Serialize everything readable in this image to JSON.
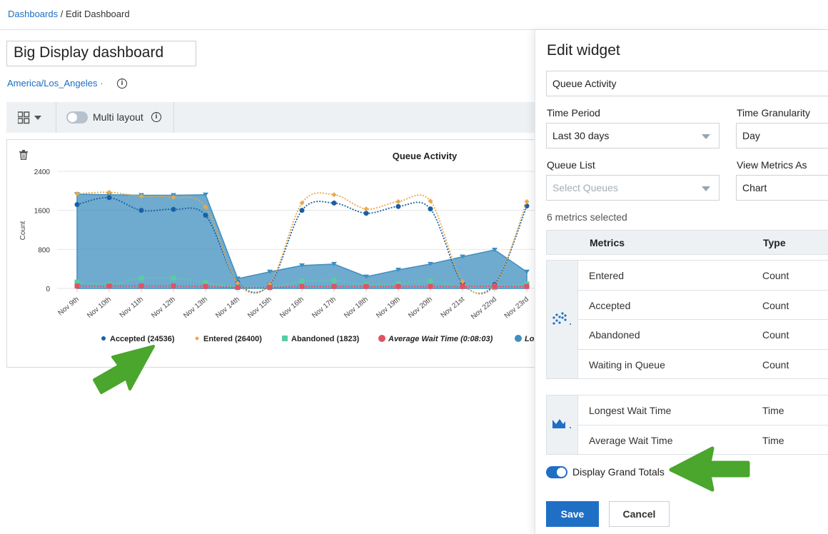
{
  "breadcrumb": {
    "root": "Dashboards",
    "separator": " / ",
    "current": "Edit Dashboard"
  },
  "dashboard": {
    "title": "Big Display dashboard",
    "timezone": "America/Los_Angeles ·"
  },
  "toolbar": {
    "multi_layout_label": "Multi layout",
    "multi_layout_on": false
  },
  "widget": {
    "title": "Queue Activity",
    "ylabel": "Count",
    "legend": [
      {
        "label": "Accepted (24536)",
        "color": "#1a5fa6",
        "marker": "circle"
      },
      {
        "label": "Entered (26400)",
        "color": "#e7a94a",
        "marker": "diamond"
      },
      {
        "label": "Abandoned (1823)",
        "color": "#5ccba4",
        "marker": "square"
      },
      {
        "label": "Average Wait Time (0:08:03)",
        "color": "#e05264",
        "marker": "circle"
      },
      {
        "label": "Lon",
        "color": "#3f8fbf",
        "marker": "circle"
      }
    ]
  },
  "chart_data": {
    "type": "line",
    "title": "Queue Activity",
    "ylabel": "Count",
    "ylim": [
      0,
      2400
    ],
    "yticks": [
      0,
      800,
      1600,
      2400
    ],
    "categories": [
      "Nov 9th",
      "Nov 10th",
      "Nov 11th",
      "Nov 12th",
      "Nov 13th",
      "Nov 14th",
      "Nov 15th",
      "Nov 16th",
      "Nov 17th",
      "Nov 18th",
      "Nov 19th",
      "Nov 20th",
      "Nov 21st",
      "Nov 22nd",
      "Nov 23rd"
    ],
    "series": [
      {
        "name": "Longest Wait Time",
        "kind": "area",
        "color": "#3f8fbf",
        "values": [
          1930,
          1920,
          1910,
          1910,
          1920,
          200,
          340,
          470,
          500,
          240,
          380,
          500,
          650,
          790,
          340
        ]
      },
      {
        "name": "Accepted",
        "kind": "line",
        "color": "#1a5fa6",
        "values": [
          1720,
          1860,
          1600,
          1620,
          1500,
          120,
          80,
          1600,
          1750,
          1540,
          1680,
          1630,
          110,
          80,
          1690
        ]
      },
      {
        "name": "Entered",
        "kind": "line",
        "color": "#e7a94a",
        "values": [
          1940,
          1970,
          1890,
          1870,
          1670,
          110,
          90,
          1750,
          1920,
          1630,
          1780,
          1790,
          140,
          60,
          1780
        ]
      },
      {
        "name": "Abandoned",
        "kind": "line",
        "color": "#5ccba4",
        "values": [
          130,
          80,
          210,
          210,
          120,
          30,
          20,
          150,
          160,
          80,
          100,
          150,
          40,
          20,
          90
        ]
      },
      {
        "name": "Average Wait Time",
        "kind": "line",
        "color": "#e05264",
        "values": [
          50,
          50,
          50,
          50,
          40,
          20,
          20,
          40,
          40,
          40,
          40,
          40,
          40,
          40,
          40
        ]
      }
    ]
  },
  "panel": {
    "title": "Edit widget",
    "widget_name": "Queue Activity",
    "time_period_label": "Time Period",
    "time_period_value": "Last 30 days",
    "time_granularity_label": "Time Granularity",
    "time_granularity_value": "Day",
    "queue_list_label": "Queue List",
    "queue_list_placeholder": "Select Queues",
    "view_metrics_label": "View Metrics As",
    "view_metrics_value": "Chart",
    "metrics_count": "6 metrics selected",
    "metrics_header": {
      "name": "Metrics",
      "type": "Type"
    },
    "line_group": [
      {
        "name": "Entered",
        "type": "Count"
      },
      {
        "name": "Accepted",
        "type": "Count"
      },
      {
        "name": "Abandoned",
        "type": "Count"
      },
      {
        "name": "Waiting in Queue",
        "type": "Count"
      }
    ],
    "area_group": [
      {
        "name": "Longest Wait Time",
        "type": "Time"
      },
      {
        "name": "Average Wait Time",
        "type": "Time"
      }
    ],
    "grand_totals_label": "Display Grand Totals",
    "grand_totals_on": true,
    "save_label": "Save",
    "cancel_label": "Cancel"
  },
  "colors": {
    "accent": "#1f6fc5",
    "link": "#1a6ec3",
    "annotation_arrow": "#4aa62c"
  }
}
